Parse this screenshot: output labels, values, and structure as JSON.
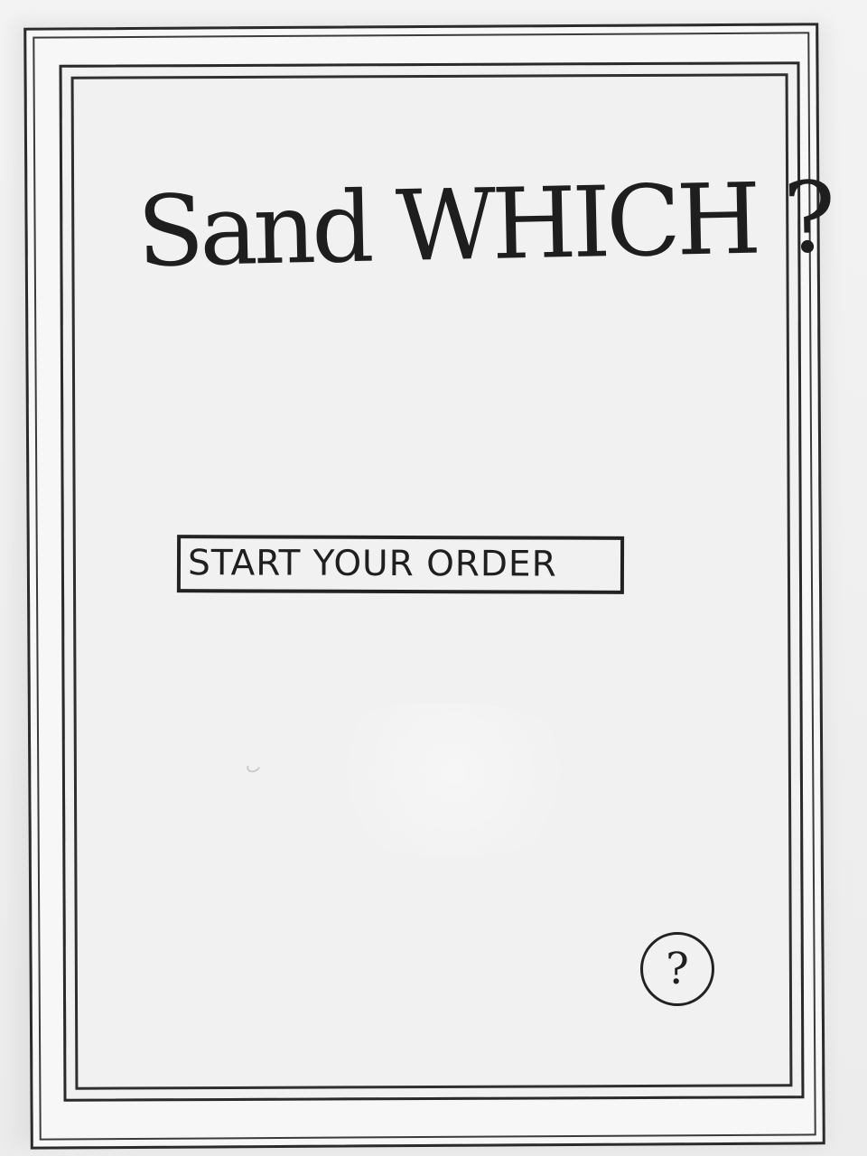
{
  "screen": {
    "title": "Sand WHICH ?",
    "start_button_label": "START YOUR ORDER",
    "help_button_label": "?"
  },
  "icons": {
    "help": "question-mark-circle-icon"
  },
  "colors": {
    "paper": "#f1f1f1",
    "ink": "#222222"
  }
}
